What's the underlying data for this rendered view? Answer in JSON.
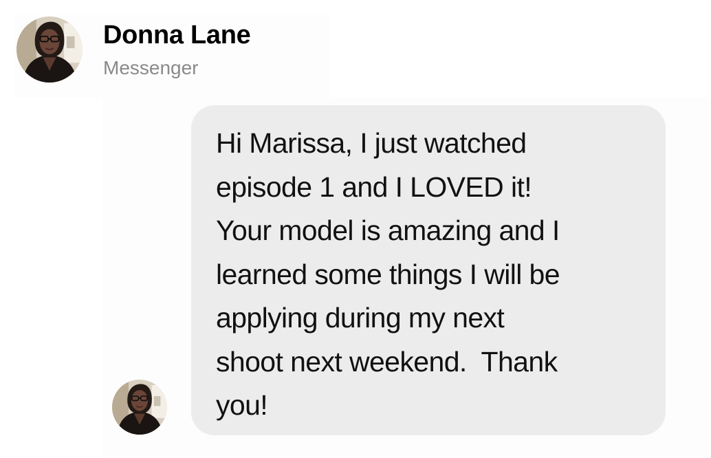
{
  "contact": {
    "name": "Donna Lane",
    "subtitle": "Messenger",
    "avatar_icon": "profile-photo-avatar"
  },
  "message": {
    "text": "Hi Marissa, I just watched\nepisode 1 and I LOVED it!\nYour model is amazing and I\nlearned some things I will be\napplying during my next\nshoot next weekend.  Thank\nyou!",
    "sender_avatar_icon": "profile-photo-avatar"
  },
  "colors": {
    "background": "#ffffff",
    "bubble": "#ececec",
    "subtitle": "#8a8a8a",
    "text": "#111111"
  }
}
